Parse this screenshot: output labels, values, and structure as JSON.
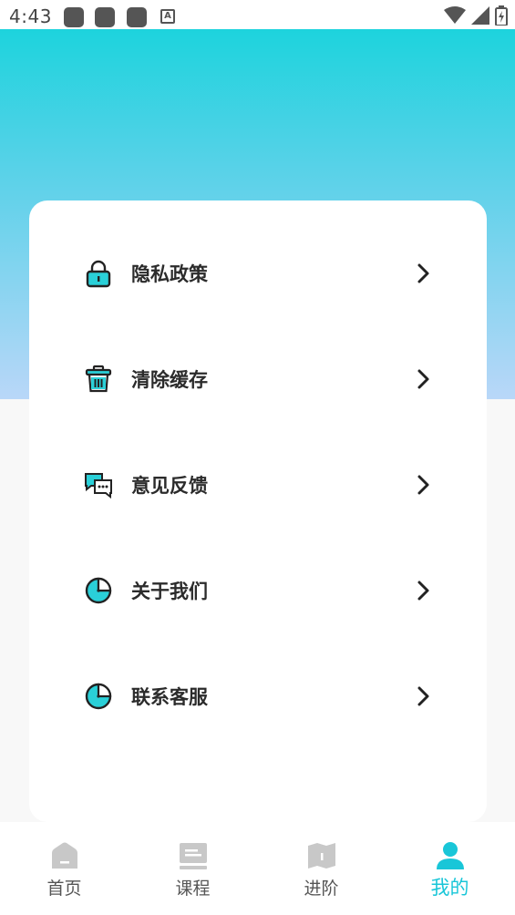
{
  "status_bar": {
    "time": "4:43"
  },
  "menu": {
    "items": [
      {
        "label": "隐私政策",
        "icon": "lock-icon"
      },
      {
        "label": "清除缓存",
        "icon": "trash-icon"
      },
      {
        "label": "意见反馈",
        "icon": "chat-bubbles-icon"
      },
      {
        "label": "关于我们",
        "icon": "clock-icon"
      },
      {
        "label": "联系客服",
        "icon": "clock-icon"
      }
    ]
  },
  "bottom_nav": {
    "items": [
      {
        "label": "首页",
        "icon": "home-icon",
        "active": false
      },
      {
        "label": "课程",
        "icon": "course-icon",
        "active": false
      },
      {
        "label": "进阶",
        "icon": "book-icon",
        "active": false
      },
      {
        "label": "我的",
        "icon": "user-icon",
        "active": true
      }
    ]
  },
  "colors": {
    "accent": "#19c6d8",
    "gradient_top": "#1dd3dd",
    "gradient_bottom": "#b9d7f8",
    "nav_inactive": "#c8c8c8"
  }
}
